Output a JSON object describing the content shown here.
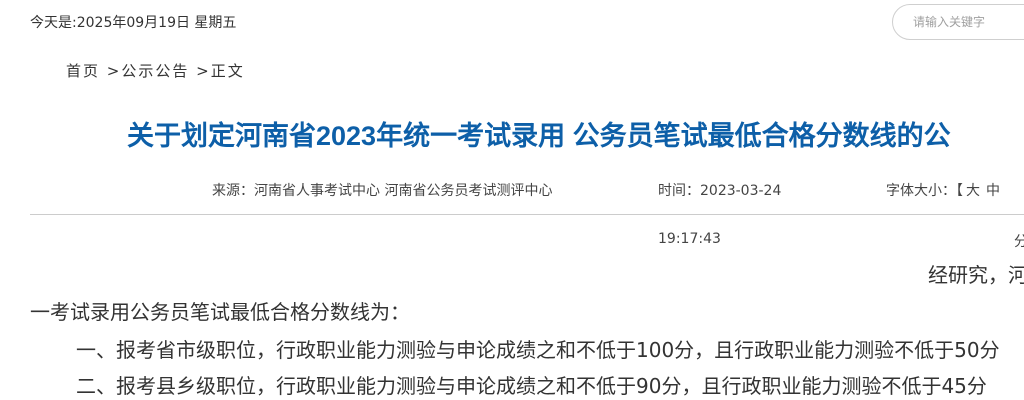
{
  "header": {
    "date_text": "今天是:2025年09月19日 星期五",
    "search_placeholder": "请输入关键字"
  },
  "breadcrumb": {
    "home": "首页",
    "sep1": " >",
    "section": "公示公告",
    "sep2": " >",
    "current": "正文"
  },
  "article": {
    "title": "关于划定河南省2023年统一考试录用 公务员笔试最低合格分数线的公",
    "source": "来源：河南省人事考试中心 河南省公务员考试测评中心",
    "time_label": "时间：2023-03-24",
    "time_rest": "19:17:43",
    "font_size_label": "字体大小：【",
    "font_size_large": "大",
    "font_size_medium": "中",
    "cut_char": "分",
    "paragraphs": [
      "经研究，河",
      "一考试录用公务员笔试最低合格分数线为：",
      "一、报考省市级职位，行政职业能力测验与申论成绩之和不低于100分，且行政职业能力测验不低于50分",
      "二、报考县乡级职位，行政职业能力测验与申论成绩之和不低于90分，且行政职业能力测验不低于45分"
    ]
  }
}
